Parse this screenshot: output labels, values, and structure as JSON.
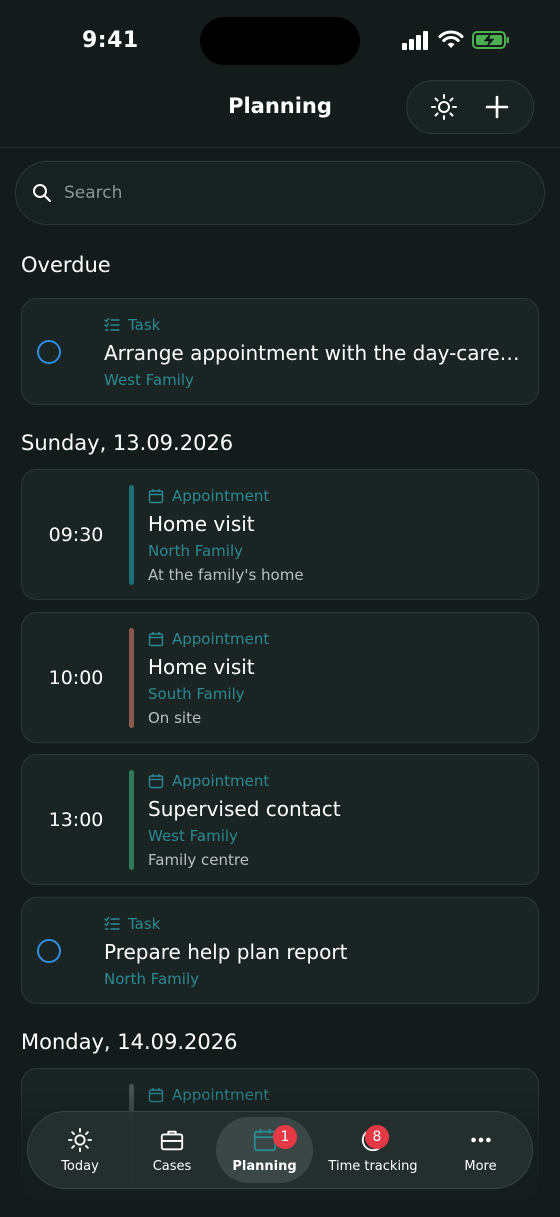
{
  "status_bar": {
    "time": "9:41"
  },
  "header": {
    "title": "Planning"
  },
  "search": {
    "placeholder": "Search"
  },
  "sections": [
    {
      "title": "Overdue"
    },
    {
      "title": "Sunday, 13.09.2026"
    },
    {
      "title": "Monday, 14.09.2026"
    }
  ],
  "overdue": {
    "type": "Task",
    "title": "Arrange appointment with the day-care ce...",
    "family": "West Family"
  },
  "sunday": [
    {
      "time": "09:30",
      "type": "Appointment",
      "title": "Home visit",
      "family": "North Family",
      "location": "At the family's home",
      "color": "#1f6f78"
    },
    {
      "time": "10:00",
      "type": "Appointment",
      "title": "Home visit",
      "family": "South Family",
      "location": "On site",
      "color": "#8a5a4e"
    },
    {
      "time": "13:00",
      "type": "Appointment",
      "title": "Supervised contact",
      "family": "West Family",
      "location": "Family centre",
      "color": "#2f7a5a"
    }
  ],
  "sunday_task": {
    "type": "Task",
    "title": "Prepare help plan report",
    "family": "North Family"
  },
  "monday": [
    {
      "type": "Appointment",
      "color": "#4a5554"
    }
  ],
  "tabs": [
    {
      "label": "Today",
      "icon": "sun-icon"
    },
    {
      "label": "Cases",
      "icon": "briefcase-icon"
    },
    {
      "label": "Planning",
      "icon": "calendar-icon",
      "badge": "1",
      "active": true
    },
    {
      "label": "Time tracking",
      "icon": "clock-icon",
      "badge": "8"
    },
    {
      "label": "More",
      "icon": "more-icon"
    }
  ],
  "colors": {
    "accent": "#2a8a93",
    "radio": "#2f8ee0",
    "badge": "#e63946",
    "background": "#131c1b"
  }
}
